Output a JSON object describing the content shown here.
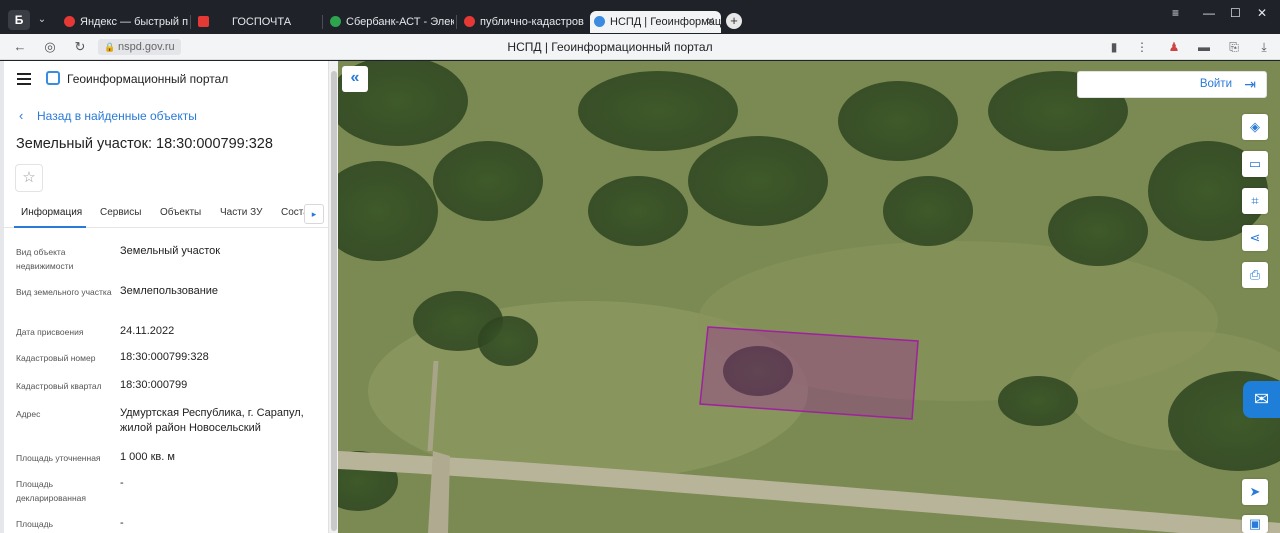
{
  "browser": {
    "tabs": [
      {
        "label": "Яндекс — быстрый поиск",
        "favicon_color": "#e53935"
      },
      {
        "label": "ГОСПОЧТА",
        "favicon_color": "#e53935"
      },
      {
        "label": "Сбербанк-АСТ - Электро",
        "favicon_color": "#2ea44f"
      },
      {
        "label": "публично-кадастровая к",
        "favicon_color": "#e53935"
      },
      {
        "label": "НСПД | Геоинформаци",
        "favicon_color": "#3b8be0"
      }
    ],
    "address": "nspd.gov.ru",
    "page_title": "НСПД | Геоинформационный портал"
  },
  "panel": {
    "portal_name": "Геоинформационный портал",
    "back_link": "Назад в найденные объекты",
    "object_title": "Земельный участок: 18:30:000799:328",
    "tabs": [
      "Информация",
      "Сервисы",
      "Объекты",
      "Части ЗУ",
      "Соста"
    ],
    "fields": [
      {
        "label": "Вид объекта недвижимости",
        "value": "Земельный участок"
      },
      {
        "label": "Вид земельного участка",
        "value": "Землепользование"
      },
      {
        "label": "Дата присвоения",
        "value": "24.11.2022"
      },
      {
        "label": "Кадастровый номер",
        "value": "18:30:000799:328"
      },
      {
        "label": "Кадастровый квартал",
        "value": "18:30:000799"
      },
      {
        "label": "Адрес",
        "value": "Удмуртская Республика, г. Сарапул, жилой район Новосельский"
      },
      {
        "label": "Площадь уточненная",
        "value": "1 000 кв. м"
      },
      {
        "label": "Площадь декларированная",
        "value": "-"
      },
      {
        "label": "Площадь",
        "value": "-"
      }
    ]
  },
  "map": {
    "login_label": "Войти",
    "accent_color": "#2a7ad9",
    "parcel_color": "#a020a0"
  }
}
